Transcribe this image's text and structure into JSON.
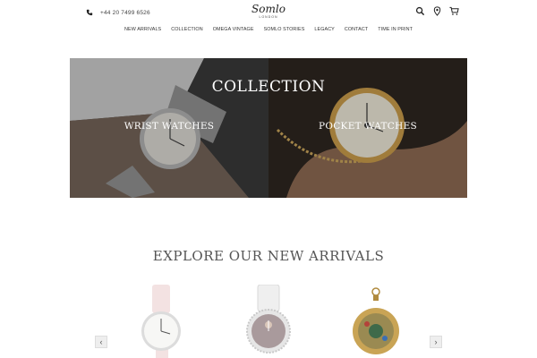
{
  "header": {
    "phone_icon": "phone-icon",
    "phone": "+44 20 7499 6526",
    "logo_name": "Somlo",
    "logo_sub": "LONDON",
    "icons": [
      "search-icon",
      "location-pin-icon",
      "cart-icon"
    ]
  },
  "nav": {
    "items": [
      "NEW ARRIVALS",
      "COLLECTION",
      "OMEGA VINTAGE",
      "SOMLO STORIES",
      "LEGACY",
      "CONTACT",
      "TIME IN PRINT"
    ]
  },
  "hero": {
    "title": "COLLECTION",
    "left_label": "WRIST WATCHES",
    "right_label": "POCKET WATCHES"
  },
  "arrivals": {
    "title": "EXPLORE OUR NEW ARRIVALS",
    "prev_icon": "chevron-left-icon",
    "next_icon": "chevron-right-icon",
    "prev": "‹",
    "next": "›"
  },
  "colors": {
    "text": "#333333",
    "hero_text": "#ffffff",
    "section_title": "#555555"
  }
}
